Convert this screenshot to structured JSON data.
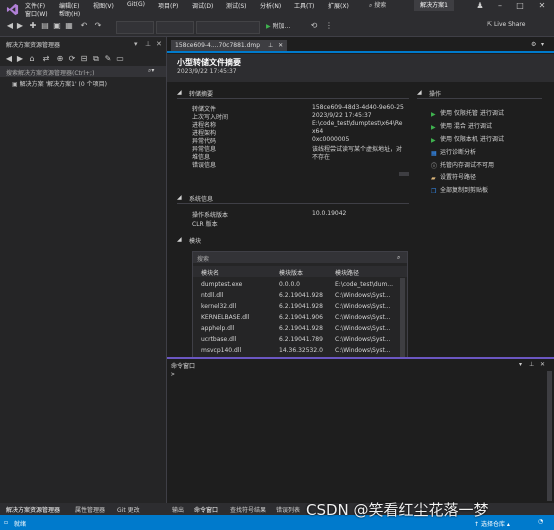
{
  "menu": {
    "items": [
      "文件(F)",
      "编辑(E)",
      "视图(V)",
      "Git(G)",
      "项目(P)",
      "调试(D)",
      "测试(S)",
      "分析(N)",
      "工具(T)",
      "扩展(X)",
      "窗口(W)",
      "帮助(H)"
    ],
    "search": "搜索",
    "solution_badge": "解决方案1"
  },
  "toolbar": {
    "attach": "附加...",
    "live_share": "Live Share"
  },
  "solution_explorer": {
    "title": "解决方案资源管理器",
    "search_placeholder": "搜索解决方案资源管理器(Ctrl+;)",
    "tree_item": "解决方案 '解决方案1' (0 个项目)"
  },
  "document": {
    "tab": "158ce609-4....70c7881.dmp",
    "title": "小型转储文件摘要",
    "time": "2023/9/22 17:45:37",
    "dump_summary": {
      "heading": "转储摘要",
      "rows": [
        {
          "k": "转储文件",
          "v": "158ce609-48d3-4d40-9e60-25"
        },
        {
          "k": "上次写入时间",
          "v": "2023/9/22 17:45:37"
        },
        {
          "k": "进程名称",
          "v": "E:\\code_test\\dumptest\\x64\\Re"
        },
        {
          "k": "进程架构",
          "v": "x64"
        },
        {
          "k": "异常代码",
          "v": "0xc0000005"
        },
        {
          "k": "异常信息",
          "v": "该线程尝试读写某个虚拟地址，对"
        },
        {
          "k": "堆信息",
          "v": "不存在"
        },
        {
          "k": "错误信息",
          "v": ""
        }
      ]
    },
    "system_info": {
      "heading": "系统信息",
      "rows": [
        {
          "k": "操作系统版本",
          "v": "10.0.19042"
        },
        {
          "k": "CLR 版本",
          "v": ""
        }
      ]
    },
    "modules": {
      "heading": "模块",
      "search_placeholder": "搜索",
      "columns": [
        "模块名",
        "模块版本",
        "模块路径"
      ],
      "rows": [
        [
          "dumptest.exe",
          "0.0.0.0",
          "E:\\code_test\\dum..."
        ],
        [
          "ntdll.dll",
          "6.2.19041.928",
          "C:\\Windows\\Syst..."
        ],
        [
          "kernel32.dll",
          "6.2.19041.928",
          "C:\\Windows\\Syst..."
        ],
        [
          "KERNELBASE.dll",
          "6.2.19041.906",
          "C:\\Windows\\Syst..."
        ],
        [
          "apphelp.dll",
          "6.2.19041.928",
          "C:\\Windows\\Syst..."
        ],
        [
          "ucrtbase.dll",
          "6.2.19041.789",
          "C:\\Windows\\Syst..."
        ],
        [
          "msvcp140.dll",
          "14.36.32532.0",
          "C:\\Windows\\Syst..."
        ]
      ]
    },
    "actions": {
      "heading": "操作",
      "items": [
        "使用 仅限托管 进行调试",
        "使用 混合 进行调试",
        "使用 仅限本机 进行调试",
        "运行诊断分析",
        "托管内存调试不可用",
        "设置符号路径",
        "全部复制到剪贴板"
      ]
    }
  },
  "command_window": {
    "title": "命令窗口",
    "prompt": ">"
  },
  "bottom_tabs": {
    "left": [
      "解决方案资源管理器",
      "属性管理器",
      "Git 更改"
    ],
    "right": [
      "输出",
      "命令窗口",
      "查找符号结果",
      "错误列表"
    ]
  },
  "status": {
    "ready": "就绪",
    "select_repo": "选择仓库",
    "watermark": "CSDN @笑看红尘花落一梦"
  },
  "colors": {
    "accent": "#007acc",
    "command_border": "#6b57c2",
    "link": "#3794ff"
  }
}
